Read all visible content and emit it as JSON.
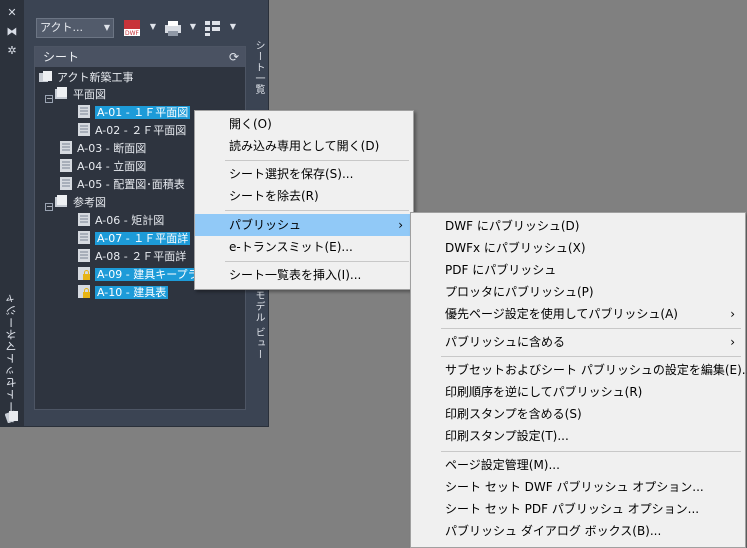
{
  "palette": {
    "title": "シートセットマネージャ",
    "combo_value": "アクト...",
    "tree_header": "シート",
    "tabs": {
      "sheet_list": "シート一覧",
      "model_views": "モデル ビュー"
    }
  },
  "tree": {
    "root": "アクト新築工事",
    "groups": [
      {
        "label": "平面図",
        "sheets": [
          "A-01 - １Ｆ平面図",
          "A-02 - ２Ｆ平面図"
        ]
      },
      {
        "label": null,
        "sheets": [
          "A-03 - 断面図",
          "A-04 - 立面図",
          "A-05 - 配置図･面積表"
        ]
      },
      {
        "label": "参考図",
        "sheets": [
          "A-06 - 矩計図",
          "A-07 - １Ｆ平面詳",
          "A-08 - ２Ｆ平面詳",
          "A-09 - 建具キープラ",
          "A-10 - 建具表"
        ]
      }
    ]
  },
  "context_menu": {
    "items": [
      "開く(O)",
      "読み込み専用として開く(D)",
      "シート選択を保存(S)...",
      "シートを除去(R)",
      "パブリッシュ",
      "e-トランスミット(E)...",
      "シート一覧表を挿入(I)..."
    ]
  },
  "publish_submenu": {
    "items": [
      "DWF にパブリッシュ(D)",
      "DWFx にパブリッシュ(X)",
      "PDF にパブリッシュ",
      "プロッタにパブリッシュ(P)",
      "優先ページ設定を使用してパブリッシュ(A)",
      "パブリッシュに含める",
      "サブセットおよびシート パブリッシュの設定を編集(E)...",
      "印刷順序を逆にしてパブリッシュ(R)",
      "印刷スタンプを含める(S)",
      "印刷スタンプ設定(T)...",
      "ページ設定管理(M)...",
      "シート セット DWF パブリッシュ オプション...",
      "シート セット PDF パブリッシュ オプション...",
      "パブリッシュ ダイアログ ボックス(B)..."
    ]
  },
  "icons": [
    "close-icon",
    "autohide-icon",
    "properties-icon",
    "publish-dwf-icon",
    "plot-icon",
    "views-icon",
    "refresh-icon",
    "sheet-icon",
    "lock-icon",
    "folder-icon",
    "sheetset-icon"
  ],
  "colors": {
    "selection": "#1d9bd8",
    "menu_highlight": "#91c9f7",
    "palette_bg": "#3b4453"
  }
}
